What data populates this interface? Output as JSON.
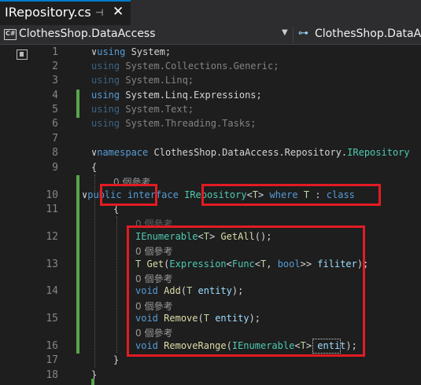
{
  "tab": {
    "title": "IRepository.cs",
    "pin_glyph": "⊣",
    "close_glyph": "✕"
  },
  "navbar": {
    "project": "ClothesShop.DataAccess",
    "namespace": "ClothesShop.DataA",
    "caret": "▼",
    "ns_icon": "⊶"
  },
  "editor": {
    "lines": [
      {
        "n": "1",
        "text": "∨using System;"
      },
      {
        "n": "2",
        "text": "using System.Collections.Generic;"
      },
      {
        "n": "3",
        "text": "using System.Linq;"
      },
      {
        "n": "4",
        "text": "using System.Linq.Expressions;"
      },
      {
        "n": "5",
        "text": "using System.Text;"
      },
      {
        "n": "6",
        "text": "using System.Threading.Tasks;"
      },
      {
        "n": "7",
        "text": ""
      },
      {
        "n": "8",
        "text": "∨namespace ClothesShop.DataAccess.Repository.IRepository"
      },
      {
        "n": "9",
        "text": "{"
      },
      {
        "n": "10",
        "text": "∨public interface IRepository<T> where T : class"
      },
      {
        "n": "11",
        "text": "{"
      },
      {
        "n": "12",
        "text": "IEnumerable<T> GetAll();"
      },
      {
        "n": "13",
        "text": "T Get(Expression<Func<T, bool>> filiter);"
      },
      {
        "n": "14",
        "text": "void Add(T entity);"
      },
      {
        "n": "15",
        "text": "void Remove(T entity);"
      },
      {
        "n": "16",
        "text": "void RemoveRange(IEnumerable<T> entit);"
      },
      {
        "n": "17",
        "text": "}"
      },
      {
        "n": "18",
        "text": "}"
      }
    ],
    "references": "0 個參考"
  }
}
